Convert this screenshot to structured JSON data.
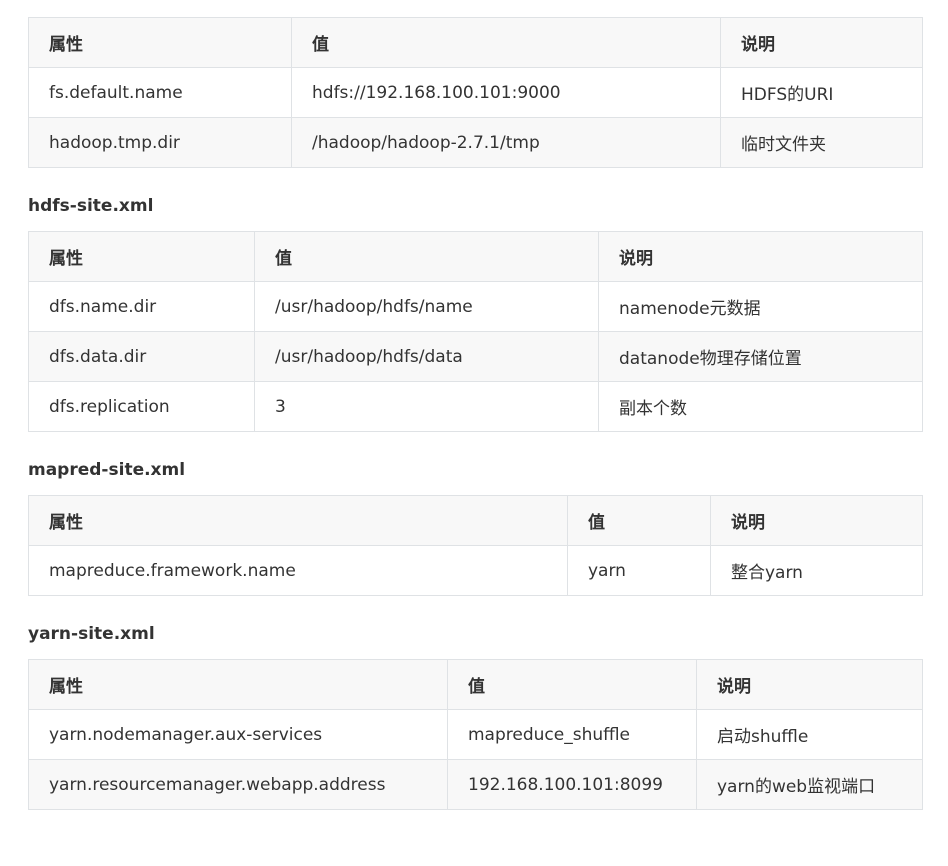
{
  "tables": [
    {
      "heading": "",
      "headers": [
        "属性",
        "值",
        "说明"
      ],
      "rows": [
        [
          "fs.default.name",
          "hdfs://192.168.100.101:9000",
          "HDFS的URI"
        ],
        [
          "hadoop.tmp.dir",
          "/hadoop/hadoop-2.7.1/tmp",
          "临时文件夹"
        ]
      ]
    },
    {
      "heading": "hdfs-site.xml",
      "headers": [
        "属性",
        "值",
        "说明"
      ],
      "rows": [
        [
          "dfs.name.dir",
          "/usr/hadoop/hdfs/name",
          "namenode元数据"
        ],
        [
          "dfs.data.dir",
          "/usr/hadoop/hdfs/data",
          "datanode物理存储位置"
        ],
        [
          "dfs.replication",
          "3",
          "副本个数"
        ]
      ]
    },
    {
      "heading": "mapred-site.xml",
      "headers": [
        "属性",
        "值",
        "说明"
      ],
      "rows": [
        [
          "mapreduce.framework.name",
          "yarn",
          "整合yarn"
        ]
      ]
    },
    {
      "heading": "yarn-site.xml",
      "headers": [
        "属性",
        "值",
        "说明"
      ],
      "rows": [
        [
          "yarn.nodemanager.aux-services",
          "mapreduce_shuffle",
          "启动shuffle"
        ],
        [
          "yarn.resourcemanager.webapp.address",
          "192.168.100.101:8099",
          "yarn的web监视端口"
        ]
      ]
    }
  ]
}
